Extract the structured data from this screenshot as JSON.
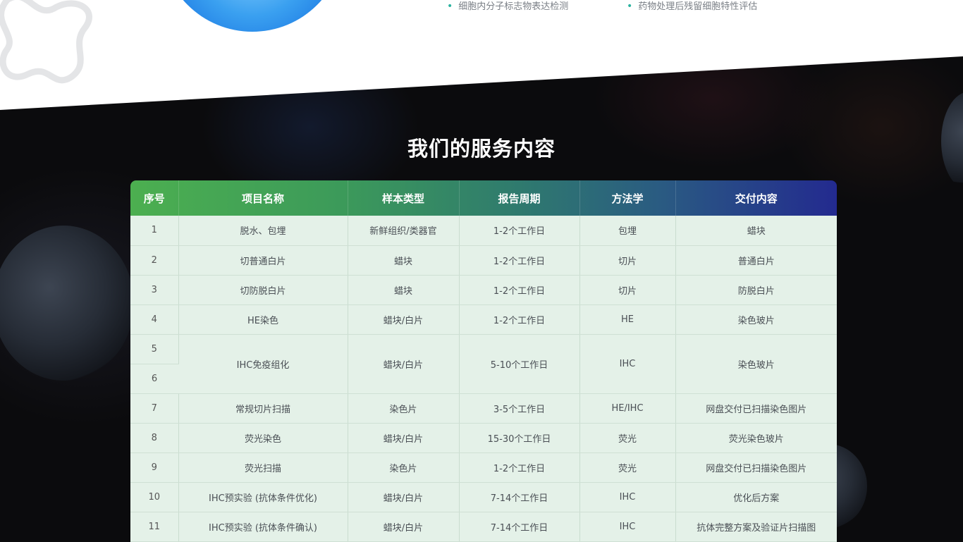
{
  "features": {
    "left": "细胞内分子标志物表达检测",
    "right": "药物处理后残留细胞特性评估"
  },
  "section_title": "我们的服务内容",
  "table": {
    "headers": [
      "序号",
      "项目名称",
      "样本类型",
      "报告周期",
      "方法学",
      "交付内容"
    ],
    "rows": [
      {
        "idx": "1",
        "name": "脱水、包埋",
        "sample": "新鲜组织/类器官",
        "period": "1-2个工作日",
        "method": "包埋",
        "deliver": "蜡块"
      },
      {
        "idx": "2",
        "name": "切普通白片",
        "sample": "蜡块",
        "period": "1-2个工作日",
        "method": "切片",
        "deliver": "普通白片"
      },
      {
        "idx": "3",
        "name": "切防脱白片",
        "sample": "蜡块",
        "period": "1-2个工作日",
        "method": "切片",
        "deliver": "防脱白片"
      },
      {
        "idx": "4",
        "name": "HE染色",
        "sample": "蜡块/白片",
        "period": "1-2个工作日",
        "method": "HE",
        "deliver": "染色玻片"
      },
      {
        "idx": "5",
        "name": "IHC免疫组化",
        "sample": "蜡块/白片",
        "period": "5-10个工作日",
        "method": "IHC",
        "deliver": "染色玻片"
      },
      {
        "idx": "6"
      },
      {
        "idx": "7",
        "name": "常规切片扫描",
        "sample": "染色片",
        "period": "3-5个工作日",
        "method": "HE/IHC",
        "deliver": "网盘交付已扫描染色图片"
      },
      {
        "idx": "8",
        "name": "荧光染色",
        "sample": "蜡块/白片",
        "period": "15-30个工作日",
        "method": "荧光",
        "deliver": "荧光染色玻片"
      },
      {
        "idx": "9",
        "name": "荧光扫描",
        "sample": "染色片",
        "period": "1-2个工作日",
        "method": "荧光",
        "deliver": "网盘交付已扫描染色图片"
      },
      {
        "idx": "10",
        "name": "IHC预实验 (抗体条件优化)",
        "sample": "蜡块/白片",
        "period": "7-14个工作日",
        "method": "IHC",
        "deliver": "优化后方案"
      },
      {
        "idx": "11",
        "name": "IHC预实验 (抗体条件确认)",
        "sample": "蜡块/白片",
        "period": "7-14个工作日",
        "method": "IHC",
        "deliver": "抗体完整方案及验证片扫描图"
      }
    ]
  }
}
